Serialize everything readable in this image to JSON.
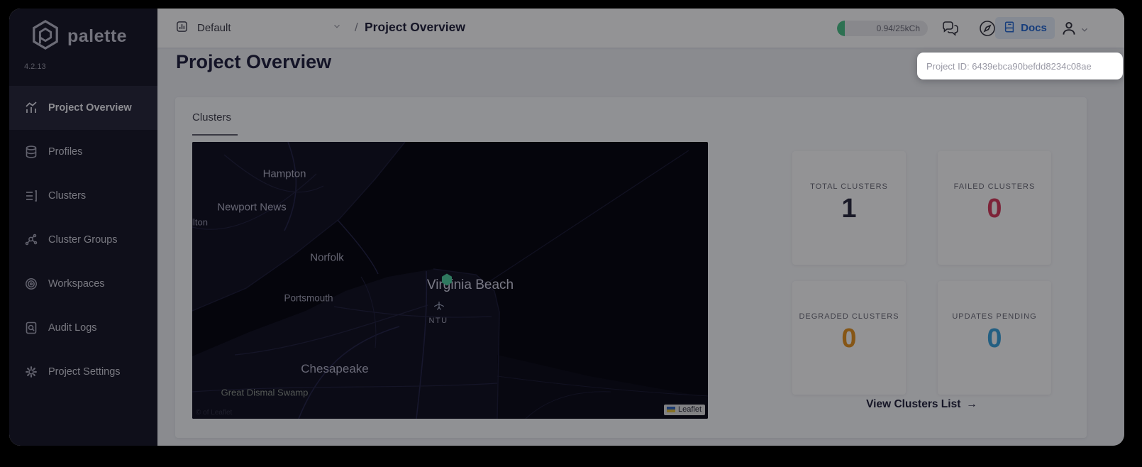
{
  "colors": {
    "usage_green": "#4cc38a",
    "docs_blue": "#2468d4",
    "marker_green": "#4fd0a0",
    "total_dark": "#2b2b40",
    "failed_red": "#d93a5c",
    "degraded_orange": "#e89420",
    "pending_blue": "#3aa4de"
  },
  "sidebar": {
    "brand": "palette",
    "version": "4.2.13",
    "items": [
      {
        "label": "Project Overview",
        "icon": "bar-chart-icon",
        "active": true
      },
      {
        "label": "Profiles",
        "icon": "database-icon",
        "active": false
      },
      {
        "label": "Clusters",
        "icon": "list-icon",
        "active": false
      },
      {
        "label": "Cluster Groups",
        "icon": "network-icon",
        "active": false
      },
      {
        "label": "Workspaces",
        "icon": "target-icon",
        "active": false
      },
      {
        "label": "Audit Logs",
        "icon": "doc-search-icon",
        "active": false
      },
      {
        "label": "Project Settings",
        "icon": "gear-icon",
        "active": false
      }
    ]
  },
  "topbar": {
    "project_selector": {
      "value": "Default"
    },
    "breadcrumb_separator": "/",
    "breadcrumb": "Project Overview",
    "usage": "0.94/25kCh",
    "docs_label": "Docs"
  },
  "tooltip": {
    "text": "Project ID: 6439ebca90befdd8234c08ae"
  },
  "page": {
    "title": "Project Overview"
  },
  "panel": {
    "tab_label": "Clusters",
    "stats": [
      {
        "label": "TOTAL CLUSTERS",
        "value": "1",
        "color": "#2b2b40"
      },
      {
        "label": "FAILED CLUSTERS",
        "value": "0",
        "color": "#d93a5c"
      },
      {
        "label": "DEGRADED CLUSTERS",
        "value": "0",
        "color": "#e89420"
      },
      {
        "label": "UPDATES PENDING",
        "value": "0",
        "color": "#3aa4de"
      }
    ],
    "view_link": "View Clusters List",
    "view_link_arrow": "→"
  },
  "map": {
    "labels": [
      {
        "text": "Hampton"
      },
      {
        "text": "Newport News"
      },
      {
        "text": "llton"
      },
      {
        "text": "Norfolk"
      },
      {
        "text": "Portsmouth"
      },
      {
        "text": "Virginia Beach"
      },
      {
        "text": "NTU"
      },
      {
        "text": "Chesapeake"
      },
      {
        "text": "Great Dismal Swamp"
      }
    ],
    "marker": {
      "type": "cluster-location",
      "near": "Virginia Beach"
    },
    "leaflet_label": "Leaflet",
    "attribution": "© of Leaflet"
  }
}
